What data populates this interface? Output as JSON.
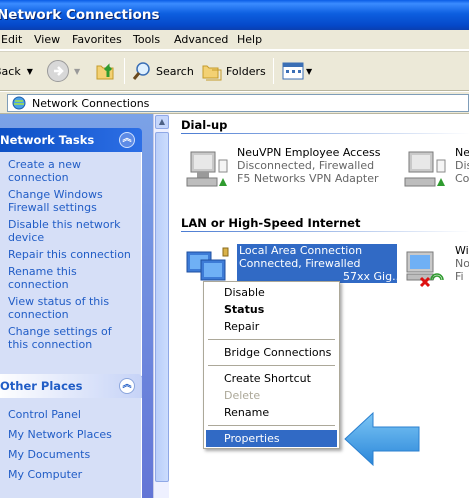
{
  "window": {
    "title": "Network Connections"
  },
  "menu": [
    "Edit",
    "View",
    "Favorites",
    "Tools",
    "Advanced",
    "Help"
  ],
  "toolbar": {
    "back_label": "Back",
    "search_label": "Search",
    "folders_label": "Folders"
  },
  "address": {
    "value": "Network Connections"
  },
  "network_tasks": {
    "title": "Network Tasks",
    "items": [
      "Create a new connection",
      "Change Windows Firewall settings",
      "Disable this network device",
      "Repair this connection",
      "Rename this connection",
      "View status of this connection",
      "Change settings of this connection"
    ]
  },
  "other_places": {
    "title": "Other Places",
    "items": [
      "Control Panel",
      "My Network Places",
      "My Documents",
      "My Computer"
    ]
  },
  "groups": {
    "dialup": "Dial-up",
    "lan": "LAN or High-Speed Internet"
  },
  "connections": {
    "vpn": {
      "name": "NeuVPN Employee Access",
      "status": "Disconnected, Firewalled",
      "device": "F5 Networks VPN Adapter"
    },
    "partial_dialup": {
      "name": "Ne",
      "status": "Dis",
      "device": "Co"
    },
    "local": {
      "name": "Local Area Connection",
      "status": "Connected, Firewalled",
      "device": "57xx Gig..."
    },
    "wireless": {
      "name": "Wi",
      "status": "No",
      "device": "Fi"
    }
  },
  "context_menu": {
    "items": [
      "Disable",
      "Status",
      "Repair",
      "Bridge Connections",
      "Create Shortcut",
      "Delete",
      "Rename",
      "Properties"
    ],
    "default_item": "Status",
    "disabled_item": "Delete",
    "highlighted_item": "Properties"
  },
  "colors": {
    "title_bar": "#0a5ce6",
    "selection": "#316ac5",
    "task_pane": "#6f8fe0",
    "arrow": "#3a9ee6"
  }
}
